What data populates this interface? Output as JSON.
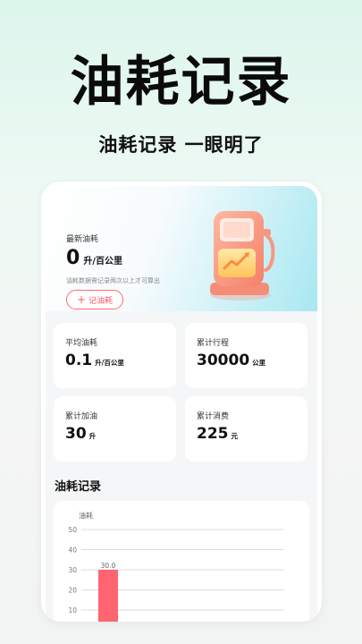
{
  "hero": {
    "title": "油耗记录",
    "subtitle": "油耗记录 一眼明了"
  },
  "latest": {
    "label": "最新油耗",
    "value": "0",
    "unit": "升/百公里",
    "note": "油耗数据需记录两次以上才可算出",
    "button_label": "记油耗",
    "button_icon": "plus-icon"
  },
  "stats": [
    {
      "label": "平均油耗",
      "value": "0.1",
      "unit": "升/百公里"
    },
    {
      "label": "累计行程",
      "value": "30000",
      "unit": "公里"
    },
    {
      "label": "累计加油",
      "value": "30",
      "unit": "升"
    },
    {
      "label": "累计消费",
      "value": "225",
      "unit": "元"
    }
  ],
  "section": {
    "title": "油耗记录"
  },
  "colors": {
    "accent": "#ff5a62",
    "bar": "#ff6470"
  },
  "chart_data": {
    "type": "bar",
    "ylabel": "油耗",
    "yticks": [
      10,
      20,
      30,
      40,
      50
    ],
    "ylim": [
      0,
      50
    ],
    "grid": true,
    "categories": [
      ""
    ],
    "values": [
      30
    ],
    "data_labels": [
      "30.0"
    ]
  }
}
